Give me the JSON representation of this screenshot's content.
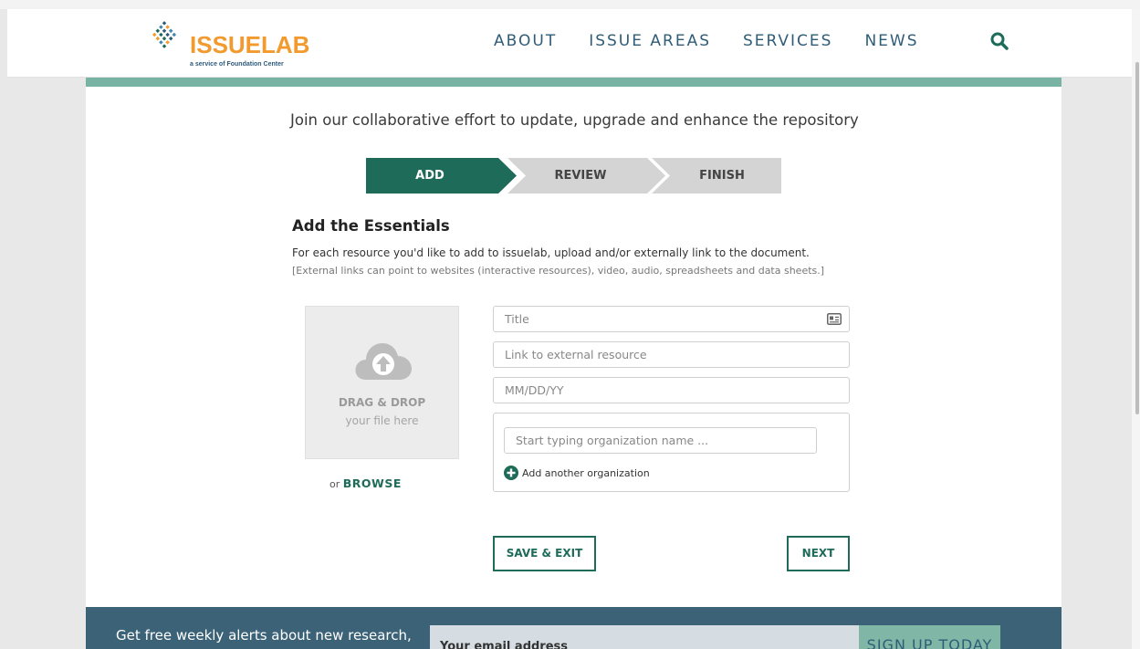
{
  "header": {
    "logo_text": "ISSUELAB",
    "logo_subtitle": "a service of Foundation Center",
    "nav": [
      "ABOUT",
      "ISSUE AREAS",
      "SERVICES",
      "NEWS"
    ]
  },
  "main": {
    "intro": "Join our collaborative effort to update, upgrade and enhance the repository",
    "steps": [
      {
        "label": "ADD",
        "active": true
      },
      {
        "label": "REVIEW",
        "active": false
      },
      {
        "label": "FINISH",
        "active": false
      }
    ],
    "section_title": "Add the Essentials",
    "description": "For each resource you'd like to add to issuelab, upload and/or externally link to the document.",
    "note": "[External links can point to websites (interactive resources), video, audio, spreadsheets and data sheets.]",
    "dropzone": {
      "title": "DRAG & DROP",
      "subtitle": "your file here"
    },
    "browse": {
      "prefix": "or",
      "link": "BROWSE"
    },
    "fields": {
      "title_placeholder": "Title",
      "link_placeholder": "Link to external resource",
      "date_placeholder": "MM/DD/YY",
      "org_placeholder": "Start typing organization name ..."
    },
    "add_org_label": "Add another organization",
    "save_exit_label": "SAVE & EXIT",
    "next_label": "NEXT"
  },
  "footer": {
    "alert_text": "Get free weekly alerts about new research,",
    "email_placeholder": "Your email address",
    "signup_label": "SIGN UP TODAY"
  },
  "colors": {
    "accent": "#1e6b5a",
    "teal_bar": "#79b3a4",
    "nav_text": "#2f5d78",
    "footer_bg": "#3c6278",
    "logo_orange": "#f39a2e"
  },
  "icons": [
    "diamond-grid-logo-icon",
    "search-icon",
    "contact-card-icon",
    "cloud-upload-icon",
    "plus-circle-icon"
  ]
}
